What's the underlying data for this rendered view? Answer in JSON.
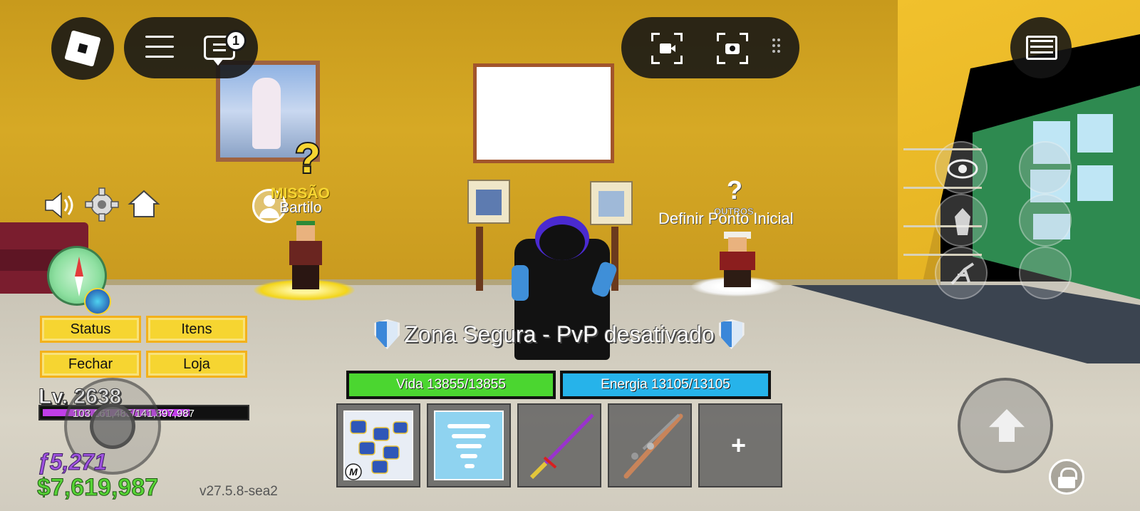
{
  "topbar": {
    "chat_badge_count": "1"
  },
  "menu": {
    "status_label": "Status",
    "items_label": "Itens",
    "close_label": "Fechar",
    "shop_label": "Loja"
  },
  "player": {
    "level_text": "Lv. 2638",
    "xp_text": "103,161,485/141,897,987",
    "xp_fraction": 0.727,
    "fragments_text": "ƒ5,271",
    "money_text": "$7,619,987"
  },
  "npcs": {
    "quest_title": "MISSÃO",
    "quest_name": "Bartilo",
    "quest_mark": "?",
    "other_mark": "?",
    "other_title": "OUTROS",
    "other_name": "Definir Ponto Inicial"
  },
  "zone": {
    "text": "Zona Segura - PvP desativado"
  },
  "bars": {
    "health_text": "Vida 13855/13855",
    "energy_text": "Energia 13105/13105",
    "health_color": "#4bd630",
    "energy_color": "#26b3ea"
  },
  "hotbar": {
    "slots": [
      {
        "icon": "superhuman-fists-icon",
        "tag": "M"
      },
      {
        "icon": "tornado-icon"
      },
      {
        "icon": "purple-katana-icon"
      },
      {
        "icon": "gun-icon"
      },
      {
        "icon": "plus-icon",
        "label": "+"
      }
    ]
  },
  "version": "v27.5.8-sea2"
}
